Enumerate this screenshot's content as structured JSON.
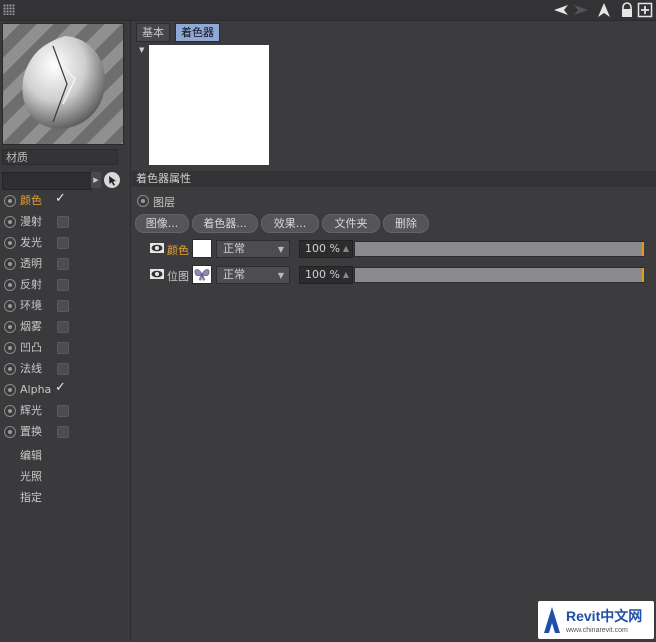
{
  "tabs": [
    "基本",
    "着色器"
  ],
  "left_panel": {
    "material_name": "材质",
    "channels": [
      {
        "label": "颜色",
        "checked": true,
        "active": true
      },
      {
        "label": "漫射",
        "checked": false
      },
      {
        "label": "发光",
        "checked": false
      },
      {
        "label": "透明",
        "checked": false
      },
      {
        "label": "反射",
        "checked": false
      },
      {
        "label": "环境",
        "checked": false
      },
      {
        "label": "烟雾",
        "checked": false
      },
      {
        "label": "凹凸",
        "checked": false
      },
      {
        "label": "法线",
        "checked": false
      },
      {
        "label": "Alpha",
        "checked": true
      },
      {
        "label": "辉光",
        "checked": false
      },
      {
        "label": "置换",
        "checked": false
      }
    ],
    "extra_items": [
      "编辑",
      "光照",
      "指定"
    ]
  },
  "shader_panel": {
    "section_title": "着色器属性",
    "layer_label": "图层",
    "buttons": [
      "图像...",
      "着色器...",
      "效果...",
      "文件夹",
      "删除"
    ],
    "layers": [
      {
        "name": "颜色",
        "mode": "正常",
        "opacity": "100 %",
        "opacity_value": 100,
        "highlight": true
      },
      {
        "name": "位图",
        "mode": "正常",
        "opacity": "100 %",
        "opacity_value": 100,
        "highlight": false
      }
    ]
  },
  "watermark": {
    "brand": "Revit中文网",
    "url": "www.chinarevit.com"
  },
  "colors": {
    "accent": "#e8a133",
    "tab_active": "#8fa8d6",
    "slider_end": "#e39a24"
  }
}
